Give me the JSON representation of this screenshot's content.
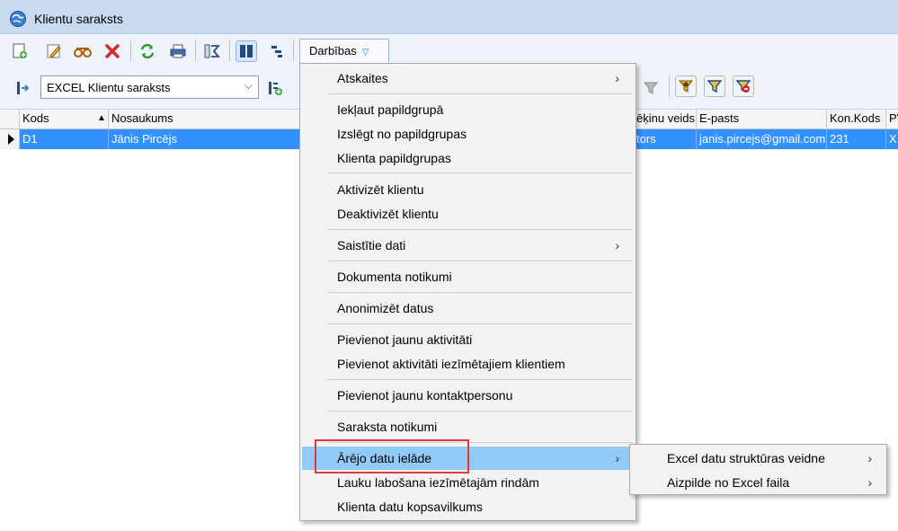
{
  "window": {
    "title": "Klientu saraksts"
  },
  "toolbar": {
    "actions_label": "Darbības"
  },
  "filter": {
    "selected": "EXCEL Klientu saraksts"
  },
  "grid": {
    "columns": [
      "Kods",
      "Nosaukums",
      "ēķinu veids",
      "E-pasts",
      "Kon.Kods",
      "PV"
    ],
    "row": {
      "kods": "D1",
      "nosaukums": "Jānis Pircējs",
      "veids": "tors",
      "epasts": "janis.pircejs@gmail.com",
      "konkods": "231",
      "pv": "X"
    }
  },
  "menu": {
    "items": [
      {
        "label": "Atskaites",
        "submenu": true
      },
      {
        "label": "Iekļaut papildgrupā"
      },
      {
        "label": "Izslēgt no papildgrupas"
      },
      {
        "label": "Klienta papildgrupas"
      },
      {
        "label": "Aktivizēt klientu"
      },
      {
        "label": "Deaktivizēt klientu"
      },
      {
        "label": "Saistītie dati",
        "submenu": true
      },
      {
        "label": "Dokumenta notikumi"
      },
      {
        "label": "Anonimizēt datus"
      },
      {
        "label": "Pievienot jaunu aktivitāti"
      },
      {
        "label": "Pievienot aktivitāti iezīmētajiem klientiem"
      },
      {
        "label": "Pievienot jaunu kontaktpersonu"
      },
      {
        "label": "Saraksta notikumi"
      },
      {
        "label": "Ārējo datu ielāde",
        "submenu": true,
        "highlighted": true
      },
      {
        "label": "Lauku labošana iezīmētajām rindām"
      },
      {
        "label": "Klienta datu kopsavilkums"
      }
    ],
    "submenu_arrow": "›"
  },
  "submenu": {
    "items": [
      {
        "label": "Excel datu struktūras veidne",
        "submenu": true
      },
      {
        "label": "Aizpilde no Excel faila",
        "submenu": true
      }
    ]
  },
  "colors": {
    "selection": "#3390ff",
    "menu_highlight": "#91c9f7",
    "callout": "#e03b3b"
  },
  "icons": [
    "globe-icon",
    "new-icon",
    "edit-icon",
    "copy-icon",
    "delete-icon",
    "refresh-icon",
    "print-icon",
    "sum-icon",
    "columns-icon",
    "tree-icon",
    "filter-icon",
    "add-filter-icon"
  ]
}
